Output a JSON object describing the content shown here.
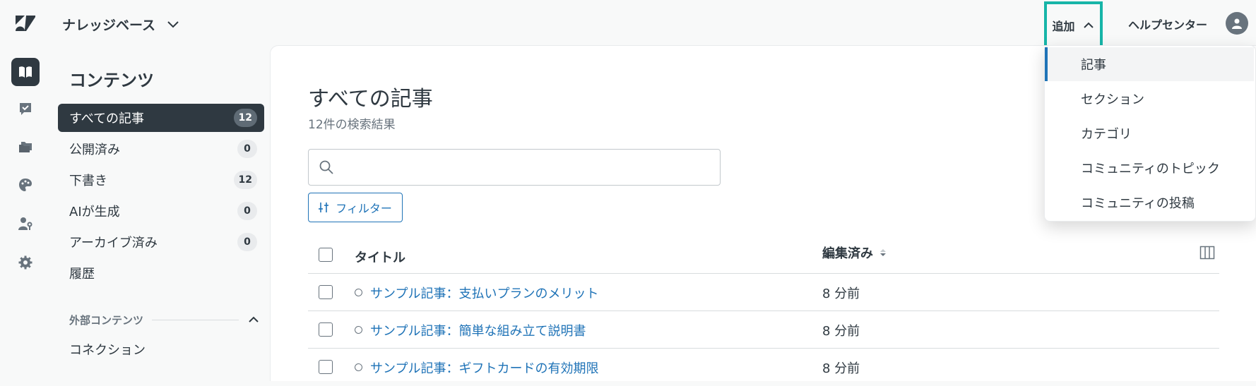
{
  "header": {
    "product_name": "ナレッジベース",
    "add_label": "追加",
    "help_center_label": "ヘルプセンター"
  },
  "rail": {
    "items": [
      {
        "icon": "book-icon",
        "active": true
      },
      {
        "icon": "checkbox-message-icon",
        "active": false
      },
      {
        "icon": "folders-icon",
        "active": false
      },
      {
        "icon": "palette-icon",
        "active": false
      },
      {
        "icon": "user-key-icon",
        "active": false
      },
      {
        "icon": "gear-icon",
        "active": false
      }
    ]
  },
  "sidebar": {
    "title": "コンテンツ",
    "items": [
      {
        "label": "すべての記事",
        "count": "12"
      },
      {
        "label": "公開済み",
        "count": "0"
      },
      {
        "label": "下書き",
        "count": "12"
      },
      {
        "label": "AIが生成",
        "count": "0"
      },
      {
        "label": "アーカイブ済み",
        "count": "0"
      },
      {
        "label": "履歴",
        "count": ""
      }
    ],
    "external_section_label": "外部コンテンツ",
    "connection_label": "コネクション"
  },
  "main": {
    "title": "すべての記事",
    "result_count": "12件の検索結果",
    "search_placeholder": "",
    "filter_label": "フィルター",
    "columns": {
      "title": "タイトル",
      "edited": "編集済み"
    },
    "rows": [
      {
        "title": "サンプル記事：支払いプランのメリット",
        "edited": "8 分前"
      },
      {
        "title": "サンプル記事：簡単な組み立て説明書",
        "edited": "8 分前"
      },
      {
        "title": "サンプル記事：ギフトカードの有効期限",
        "edited": "8 分前"
      }
    ]
  },
  "dropdown": {
    "items": [
      "記事",
      "セクション",
      "カテゴリ",
      "コミュニティのトピック",
      "コミュニティの投稿"
    ]
  },
  "colors": {
    "accent_blue": "#1f73b7",
    "highlight_teal": "#17b5a8",
    "dark": "#2f3941"
  }
}
